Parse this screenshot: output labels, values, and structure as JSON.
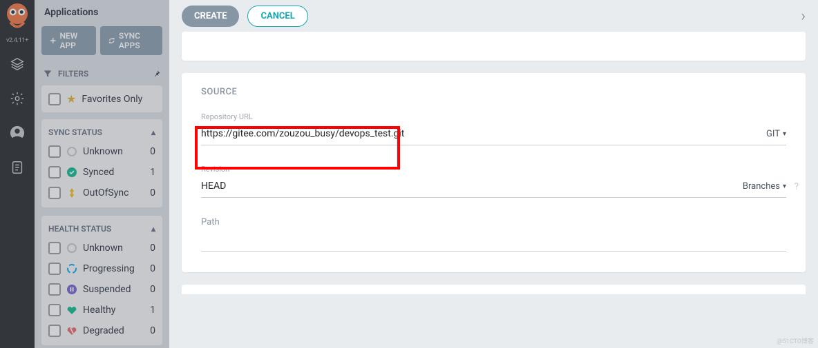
{
  "version": "v2.4.11+",
  "sidebar": {
    "title": "Applications",
    "new_app": "NEW APP",
    "sync_apps": "SYNC APPS",
    "filters_label": "FILTERS",
    "favorites_label": "Favorites Only",
    "sync_status": {
      "label": "SYNC STATUS",
      "items": [
        {
          "label": "Unknown",
          "count": "0",
          "color": "#c7ccd1"
        },
        {
          "label": "Synced",
          "count": "1",
          "color": "#18be94"
        },
        {
          "label": "OutOfSync",
          "count": "0",
          "color": "#f4c030"
        }
      ]
    },
    "health_status": {
      "label": "HEALTH STATUS",
      "items": [
        {
          "label": "Unknown",
          "count": "0",
          "color": "#c7ccd1"
        },
        {
          "label": "Progressing",
          "count": "0",
          "color": "#0dadea"
        },
        {
          "label": "Suspended",
          "count": "0",
          "color": "#7a6bd0"
        },
        {
          "label": "Healthy",
          "count": "1",
          "color": "#18be94"
        },
        {
          "label": "Degraded",
          "count": "0",
          "color": "#e96d76"
        }
      ]
    }
  },
  "form": {
    "create": "CREATE",
    "cancel": "CANCEL",
    "source_title": "SOURCE",
    "repo_label": "Repository URL",
    "repo_value": "https://gitee.com/zouzou_busy/devops_test.git",
    "repo_type": "GIT",
    "revision_label": "Revision",
    "revision_value": "HEAD",
    "revision_type": "Branches",
    "path_label": "Path",
    "path_value": ""
  }
}
